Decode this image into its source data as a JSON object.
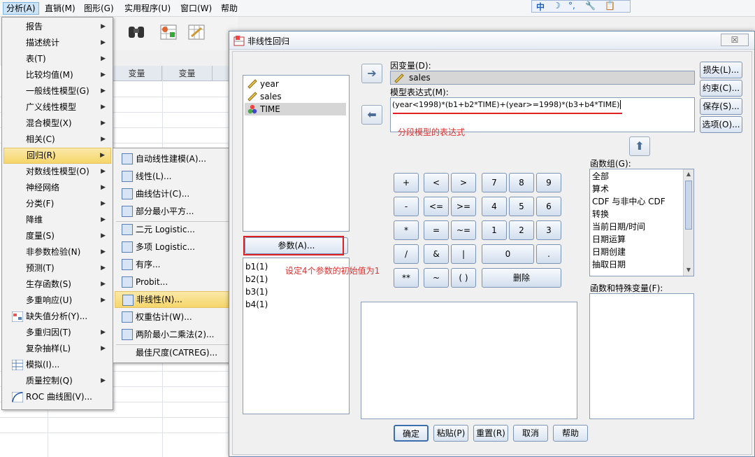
{
  "menubar": {
    "items": [
      "分析(A)",
      "直销(M)",
      "图形(G)",
      "实用程序(U)",
      "窗口(W)",
      "帮助"
    ],
    "ime": [
      "中",
      "☽",
      "°,",
      "🔧",
      "📋"
    ]
  },
  "grid": {
    "headers": [
      "变量",
      "变量"
    ]
  },
  "analyze_menu": {
    "items": [
      {
        "label": "报告",
        "arrow": true
      },
      {
        "label": "描述统计",
        "arrow": true
      },
      {
        "label": "表(T)",
        "arrow": true
      },
      {
        "label": "比较均值(M)",
        "arrow": true
      },
      {
        "label": "一般线性模型(G)",
        "arrow": true
      },
      {
        "label": "广义线性模型",
        "arrow": true
      },
      {
        "label": "混合模型(X)",
        "arrow": true
      },
      {
        "label": "相关(C)",
        "arrow": true
      },
      {
        "label": "回归(R)",
        "arrow": true
      },
      {
        "label": "对数线性模型(O)",
        "arrow": true
      },
      {
        "label": "神经网络",
        "arrow": true
      },
      {
        "label": "分类(F)",
        "arrow": true
      },
      {
        "label": "降维",
        "arrow": true
      },
      {
        "label": "度量(S)",
        "arrow": true
      },
      {
        "label": "非参数检验(N)",
        "arrow": true
      },
      {
        "label": "预测(T)",
        "arrow": true
      },
      {
        "label": "生存函数(S)",
        "arrow": true
      },
      {
        "label": "多重响应(U)",
        "arrow": true
      },
      {
        "label": "缺失值分析(Y)...",
        "arrow": false
      },
      {
        "label": "多重归因(T)",
        "arrow": true
      },
      {
        "label": "复杂抽样(L)",
        "arrow": true
      },
      {
        "label": "模拟(I)...",
        "arrow": false
      },
      {
        "label": "质量控制(Q)",
        "arrow": true
      },
      {
        "label": "ROC 曲线图(V)...",
        "arrow": false
      }
    ]
  },
  "regression_menu": {
    "items": [
      "自动线性建模(A)...",
      "线性(L)...",
      "曲线估计(C)...",
      "部分最小平方...",
      "二元 Logistic...",
      "多项 Logistic...",
      "有序...",
      "Probit...",
      "非线性(N)...",
      "权重估计(W)...",
      "两阶最小二乘法(2)...",
      "最佳尺度(CATREG)..."
    ]
  },
  "dialog": {
    "title": "非线性回归",
    "close": "☒",
    "variables": [
      "year",
      "sales",
      "TIME"
    ],
    "dependent_label": "因变量(D):",
    "dependent_value": "sales",
    "model_label": "模型表达式(M):",
    "model_expr": "(year<1998)*(b1+b2*TIME)+(year>=1998)*(b3+b4*TIME)",
    "annotation_model": "分段模型的表达式",
    "params_button": "参数(A)...",
    "params": [
      "b1(1)",
      "b2(1)",
      "b3(1)",
      "b4(1)"
    ],
    "annotation_params": "设定4个参数的初始值为1",
    "side_buttons": [
      "损失(L)...",
      "约束(C)...",
      "保存(S)...",
      "选项(O)..."
    ],
    "func_group_label": "函数组(G):",
    "func_groups": [
      "全部",
      "算术",
      "CDF 与非中心 CDF",
      "转换",
      "当前日期/时间",
      "日期运算",
      "日期创建",
      "抽取日期"
    ],
    "func_special_label": "函数和特殊变量(F):",
    "keypad": [
      "+",
      "<",
      ">",
      "7",
      "8",
      "9",
      "-",
      "<=",
      ">=",
      "4",
      "5",
      "6",
      "*",
      "=",
      "~=",
      "1",
      "2",
      "3",
      "/",
      "&",
      "|",
      "0",
      ".",
      "**",
      "~",
      "( )",
      "删除"
    ],
    "bottom_buttons": [
      "确定",
      "粘贴(P)",
      "重置(R)",
      "取消",
      "帮助"
    ]
  },
  "colors": {
    "accent": "#e02020",
    "highlight": "#f6d66a",
    "selection": "#d6d6d6"
  }
}
